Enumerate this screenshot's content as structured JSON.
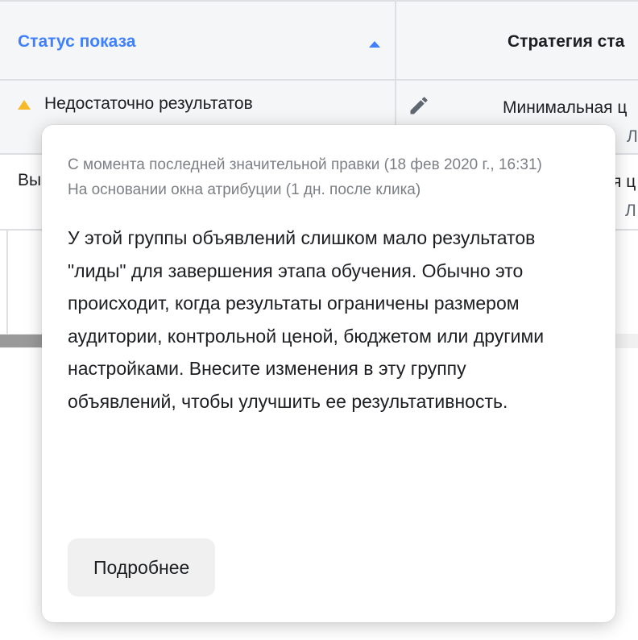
{
  "table": {
    "columns": [
      {
        "label": "Статус показа",
        "sorted": "asc"
      },
      {
        "label": "Стратегия ста"
      }
    ],
    "rows": [
      {
        "status": "Недостаточно результатов",
        "status_icon": "warning-triangle-icon",
        "strategy": "Минимальная ц",
        "strategy_sub": "Л"
      },
      {
        "status": "Вы",
        "strategy": "я ц",
        "strategy_sub": "Л"
      }
    ]
  },
  "popover": {
    "meta_line1": "С момента последней значительной правки (18 фев 2020 г., 16:31)",
    "meta_line2": "На основании окна атрибуции (1 дн. после клика)",
    "body": "У этой группы объявлений слишком мало результатов \"лиды\" для завершения этапа обучения. Обычно это происходит, когда результаты ограничены размером аудитории, контрольной ценой, бюджетом или другими настройками. Внесите изменения в эту группу объявлений, чтобы улучшить ее результативность.",
    "more_button_label": "Подробнее"
  },
  "colors": {
    "accent": "#4080ff",
    "warning": "#f7b928",
    "header_bg": "#f5f6f7",
    "border": "#dddfe2"
  }
}
